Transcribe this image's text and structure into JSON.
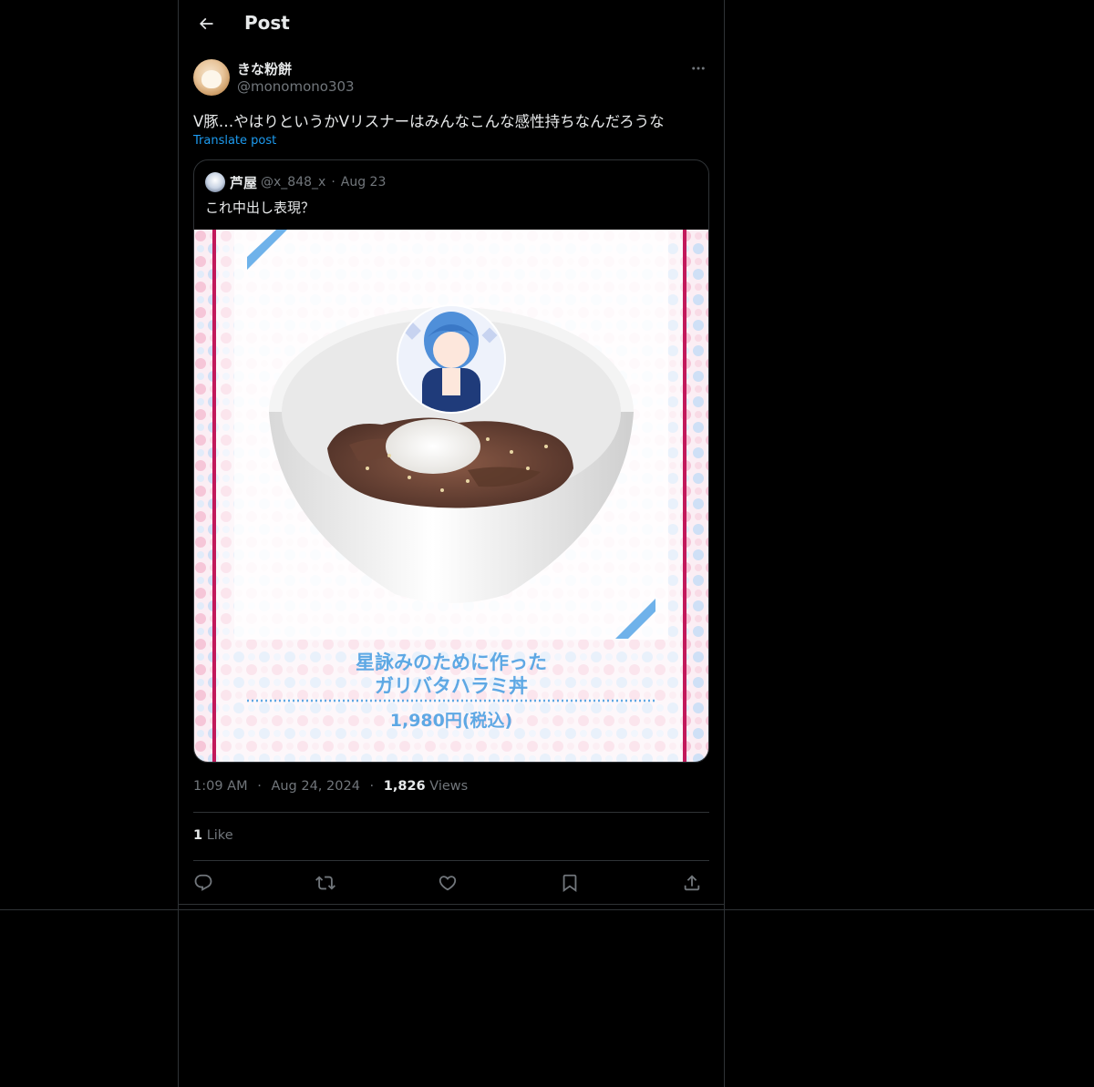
{
  "header": {
    "title": "Post",
    "back_icon": "arrow-left-icon"
  },
  "post": {
    "author": {
      "display_name": "きな粉餅",
      "handle": "@monomono303"
    },
    "more_icon": "more-horizontal-icon",
    "text": "V豚…やはりというかVリスナーはみんなこんな感性持ちなんだろうな",
    "translate_label": "Translate post",
    "quote": {
      "author_name": "芦屋",
      "author_handle": "@x_848_x",
      "separator": "·",
      "date": "Aug 23",
      "text": "これ中出し表現？",
      "image": {
        "title_line1": "星詠みのために作った",
        "title_line2": "ガリバタハラミ丼",
        "price": "1,980円(税込)"
      }
    },
    "meta": {
      "time": "1:09 AM",
      "dot1": "·",
      "date": "Aug 24, 2024",
      "dot2": "·",
      "views_count": "1,826",
      "views_label": "Views"
    },
    "likes": {
      "count": "1",
      "label": "Like"
    },
    "actions": [
      "reply-icon",
      "repost-icon",
      "like-icon",
      "bookmark-icon",
      "share-icon"
    ]
  },
  "colors": {
    "background": "#000000",
    "text": "#e7e9ea",
    "muted": "#71767b",
    "link": "#1d9bf0",
    "border": "#2f3336"
  }
}
